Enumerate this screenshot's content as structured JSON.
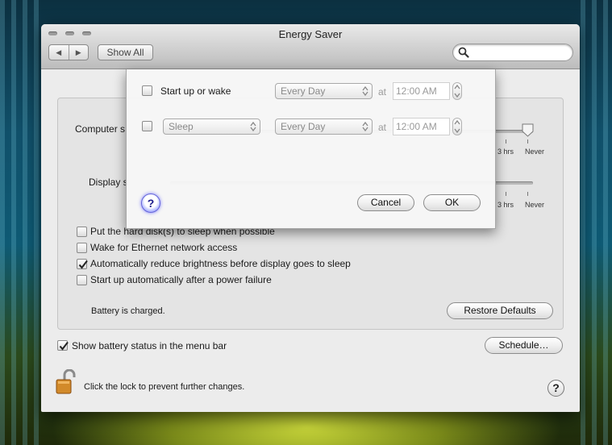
{
  "window": {
    "title": "Energy Saver"
  },
  "toolbar": {
    "back": "◀",
    "forward": "▶",
    "show_all": "Show All",
    "search_placeholder": ""
  },
  "panel": {
    "computer_sleep_label": "Computer s",
    "display_sleep_label": "Display s",
    "slider_labels": {
      "three_hrs": "3 hrs",
      "never": "Never"
    },
    "options": [
      {
        "label": "Put the hard disk(s) to sleep when possible",
        "checked": false
      },
      {
        "label": "Wake for Ethernet network access",
        "checked": false
      },
      {
        "label": "Automatically reduce brightness before display goes to sleep",
        "checked": true
      },
      {
        "label": "Start up automatically after a power failure",
        "checked": false
      }
    ],
    "battery_status": "Battery is charged.",
    "restore_defaults": "Restore Defaults"
  },
  "show_battery_status": {
    "label": "Show battery status in the menu bar",
    "checked": true
  },
  "schedule_button": "Schedule…",
  "lock_text": "Click the lock to prevent further changes.",
  "help_glyph": "?",
  "schedule_sheet": {
    "row1": {
      "label": "Start up or wake",
      "checked": false,
      "frequency": "Every Day",
      "at": "at",
      "time": "12:00 AM"
    },
    "row2": {
      "action": "Sleep",
      "checked": false,
      "frequency": "Every Day",
      "at": "at",
      "time": "12:00 AM"
    },
    "cancel": "Cancel",
    "ok": "OK"
  },
  "colors": {
    "accent_help": "#6b6cff",
    "window_bg": "#ececec"
  }
}
